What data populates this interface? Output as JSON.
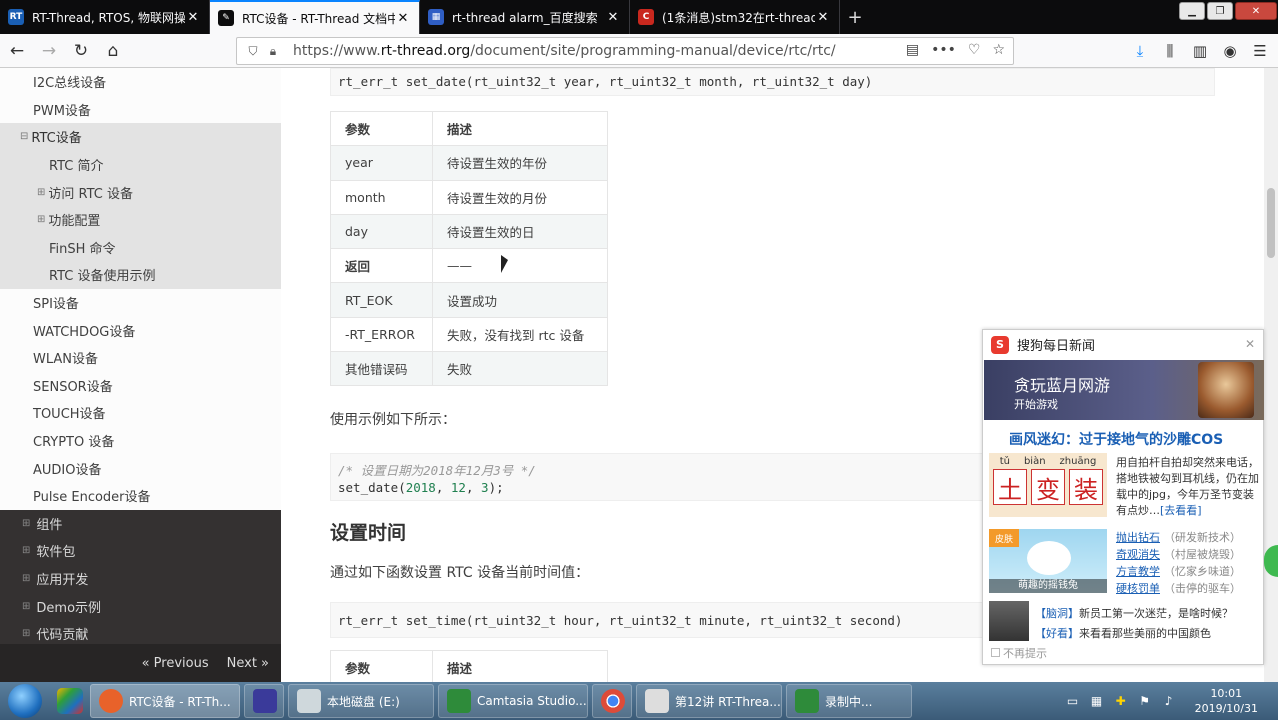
{
  "browser": {
    "tabs": [
      {
        "title": "RT-Thread, RTOS, 物联网操作",
        "active": false,
        "favicon": "rt-thread-icon"
      },
      {
        "title": "RTC设备 - RT-Thread 文档中心",
        "active": true,
        "favicon": "document-icon"
      },
      {
        "title": "rt-thread alarm_百度搜索",
        "active": false,
        "favicon": "baidu-icon"
      },
      {
        "title": "(1条消息)stm32在rt-thread上",
        "active": false,
        "favicon": "csdn-icon"
      }
    ],
    "url_prefix": "https://www.",
    "url_domain": "rt-thread.org",
    "url_path": "/document/site/programming-manual/device/rtc/rtc/"
  },
  "sidebar": {
    "items": [
      {
        "label": "I2C总线设备"
      },
      {
        "label": "PWM设备"
      },
      {
        "label": "RTC设备"
      },
      {
        "label": "RTC 简介"
      },
      {
        "label": "访问 RTC 设备"
      },
      {
        "label": "功能配置"
      },
      {
        "label": "FinSH 命令"
      },
      {
        "label": "RTC 设备使用示例"
      },
      {
        "label": "SPI设备"
      },
      {
        "label": "WATCHDOG设备"
      },
      {
        "label": "WLAN设备"
      },
      {
        "label": "SENSOR设备"
      },
      {
        "label": "TOUCH设备"
      },
      {
        "label": "CRYPTO 设备"
      },
      {
        "label": "AUDIO设备"
      },
      {
        "label": "Pulse Encoder设备"
      }
    ],
    "top_items": [
      {
        "label": "组件"
      },
      {
        "label": "软件包"
      },
      {
        "label": "应用开发"
      },
      {
        "label": "Demo示例"
      },
      {
        "label": "代码贡献"
      }
    ],
    "prev_label": "« Previous",
    "next_label": "Next »"
  },
  "content": {
    "code1": "rt_err_t set_date(rt_uint32_t year, rt_uint32_t month, rt_uint32_t day)",
    "table1": {
      "headers": [
        "参数",
        "描述"
      ],
      "rows": [
        [
          "year",
          "待设置生效的年份"
        ],
        [
          "month",
          "待设置生效的月份"
        ],
        [
          "day",
          "待设置生效的日"
        ],
        [
          "返回",
          "——"
        ],
        [
          "RT_EOK",
          "设置成功"
        ],
        [
          "-RT_ERROR",
          "失败，没有找到 rtc 设备"
        ],
        [
          "其他错误码",
          "失败"
        ]
      ]
    },
    "example_intro": "使用示例如下所示：",
    "code2_comment": "/* 设置日期为2018年12月3号 */",
    "code2_fn": "set_date(",
    "code2_a1": "2018",
    "code2_a2": "12",
    "code2_a3": "3",
    "code2_end": ");",
    "h2_settime": "设置时间",
    "settime_intro": "通过如下函数设置 RTC 设备当前时间值：",
    "code3": "rt_err_t set_time(rt_uint32_t hour, rt_uint32_t minute, rt_uint32_t second)",
    "table2_headers": [
      "参数",
      "描述"
    ]
  },
  "popup": {
    "title": "搜狗每日新闻",
    "banner_title": "贪玩蓝月网游",
    "banner_sub": "开始游戏",
    "headline": "画风迷幻：过于接地气的沙雕COS",
    "art1_pinyin": [
      "tǔ",
      "biàn",
      "zhuāng"
    ],
    "art1_chars": [
      "土",
      "变",
      "装"
    ],
    "art1_text": "用自拍杆自拍却突然来电话，搭地铁被勾到耳机线，仍在加载中的jpg，今年万圣节变装有点炒…",
    "art1_link": "[去看看]",
    "art2_tag": "皮肤",
    "art2_caption": "萌趣的摇钱兔",
    "links": [
      {
        "link": "抛出钻石",
        "note": "（研发新技术）"
      },
      {
        "link": "奇观消失",
        "note": "（村屋被烧毁）"
      },
      {
        "link": "方言教学",
        "note": "（忆家乡味道）"
      },
      {
        "link": "硬核罚单",
        "note": "（击停的驱车）"
      }
    ],
    "news": [
      {
        "bracket": "【脑洞】",
        "text": "新员工第一次迷茫，是啥时候？"
      },
      {
        "bracket": "【好看】",
        "text": "来看看那些美丽的中国颜色"
      }
    ],
    "noshow": "不再提示"
  },
  "taskbar": {
    "buttons": [
      {
        "label": "RTC设备 - RT-Th...",
        "active": true,
        "color": "#e8622a"
      },
      {
        "label": "",
        "active": false,
        "color": "#3a3a9a"
      },
      {
        "label": "本地磁盘 (E:)",
        "active": false,
        "color": "#cfd8dc"
      },
      {
        "label": "Camtasia Studio...",
        "active": false,
        "color": "#2e8b3a"
      },
      {
        "label": "",
        "active": false,
        "color": "#dd4b39"
      },
      {
        "label": "第12讲 RT-Threa...",
        "active": false,
        "color": "#dddddd"
      },
      {
        "label": "录制中...",
        "active": false,
        "color": "#2e8b3a"
      }
    ],
    "time": "10:01",
    "date": "2019/10/31"
  }
}
